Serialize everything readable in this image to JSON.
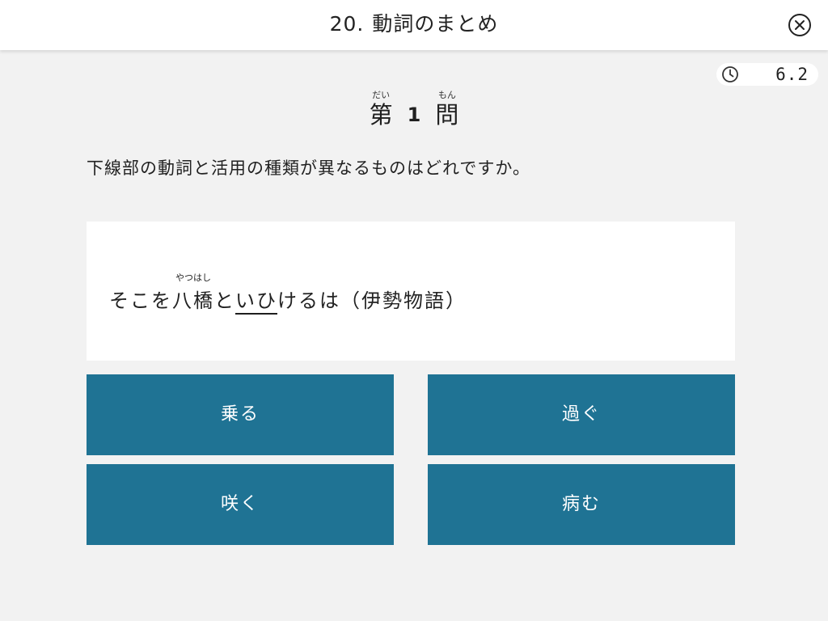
{
  "header": {
    "number": "20.",
    "title": "動詞のまとめ",
    "close_icon": "close-circle-icon"
  },
  "timer": {
    "icon": "clock-icon",
    "value": "6.2"
  },
  "question_number": {
    "prefix": "第",
    "prefix_ruby": "だい",
    "number": "1",
    "suffix": "問",
    "suffix_ruby": "もん"
  },
  "question_text": "下線部の動詞と活用の種類が異なるものはどれですか。",
  "passage": {
    "before": "そこを",
    "ruby_base": "八橋",
    "ruby_text": "やつはし",
    "middle": "と",
    "underlined": "いひ",
    "after": "けるは（伊勢物語）"
  },
  "choices": [
    {
      "label": "乗る"
    },
    {
      "label": "過ぐ"
    },
    {
      "label": "咲く"
    },
    {
      "label": "病む"
    }
  ],
  "colors": {
    "choice_background": "#1f7394",
    "page_background": "#f2f2f2"
  }
}
